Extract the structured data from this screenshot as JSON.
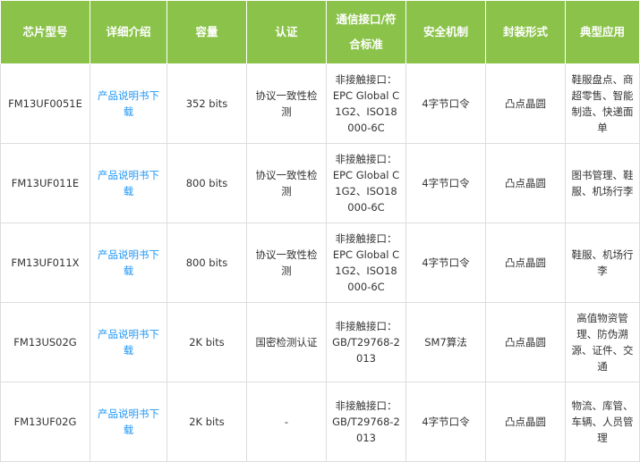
{
  "table": {
    "headers": [
      "芯片型号",
      "详细介绍",
      "容量",
      "认证",
      "通信接口/符合标准",
      "安全机制",
      "封装形式",
      "典型应用"
    ],
    "rows": [
      {
        "model": "FM13UF0051E",
        "intro": "产品说明书下载",
        "capacity": "352 bits",
        "certification": "协议一致性检测",
        "interface": "非接触接口：EPC Global C1G2、ISO18000-6C",
        "security": "4字节口令",
        "package": "凸点晶圆",
        "application": "鞋服盘点、商超零售、智能制造、快递面单"
      },
      {
        "model": "FM13UF011E",
        "intro": "产品说明书下载",
        "capacity": "800 bits",
        "certification": "协议一致性检测",
        "interface": "非接触接口：EPC Global C1G2、ISO18000-6C",
        "security": "4字节口令",
        "package": "凸点晶圆",
        "application": "图书管理、鞋服、机场行李"
      },
      {
        "model": "FM13UF011X",
        "intro": "产品说明书下载",
        "capacity": "800 bits",
        "certification": "协议一致性检测",
        "interface": "非接触接口：EPC Global C1G2、ISO18000-6C",
        "security": "4字节口令",
        "package": "凸点晶圆",
        "application": "鞋服、机场行李"
      },
      {
        "model": "FM13US02G",
        "intro": "产品说明书下载",
        "capacity": "2K bits",
        "certification": "国密检测认证",
        "interface": "非接触接口：GB/T29768-2013",
        "security": "SM7算法",
        "package": "凸点晶圆",
        "application": "高值物资管理、防伪溯源、证件、交通"
      },
      {
        "model": "FM13UF02G",
        "intro": "产品说明书下载",
        "capacity": "2K bits",
        "certification": "-",
        "interface": "非接触接口：GB/T29768-2013",
        "security": "4字节口令",
        "package": "凸点晶圆",
        "application": "物流、库管、车辆、人员管理"
      }
    ]
  }
}
